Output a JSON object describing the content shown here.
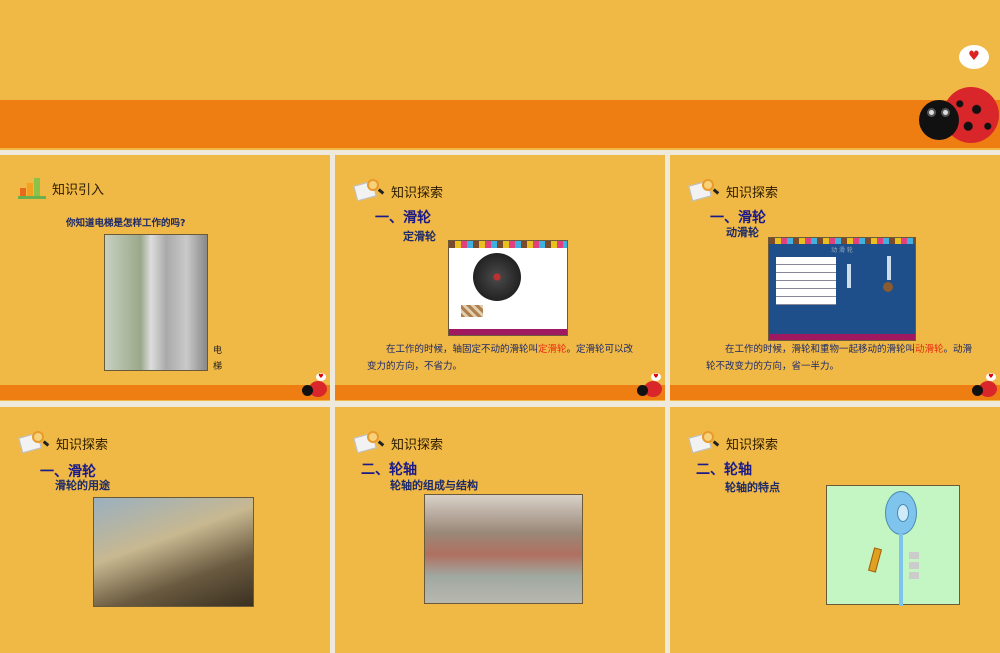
{
  "slides": [
    {
      "header": "知识引入",
      "question": "你知道电梯是怎样工作的吗?",
      "caption_chars": [
        "电",
        "梯"
      ]
    },
    {
      "header": "知识探索",
      "section": "一、滑轮",
      "subtitle": "定滑轮",
      "para_before": "在工作的时候，轴固定不动的滑轮叫",
      "para_highlight": "定滑轮",
      "para_after": "。定滑轮可以改变力的方向，不省力。"
    },
    {
      "header": "知识探索",
      "section": "一、滑轮",
      "subtitle": "动滑轮",
      "sim_title": "动 滑 轮",
      "para_before": "在工作的时候，滑轮和重物一起移动的滑轮叫",
      "para_highlight": "动滑轮",
      "para_after": "。动滑轮不改变力的方向，省一半力。"
    },
    {
      "header": "知识探索",
      "section": "一、滑轮",
      "subtitle": "滑轮的用途"
    },
    {
      "header": "知识探索",
      "section": "二、轮轴",
      "subtitle": "轮轴的组成与结构"
    },
    {
      "header": "知识探索",
      "section": "二、轮轴",
      "subtitle": "轮轴的特点"
    }
  ],
  "colors": {
    "background": "#f0b845",
    "band": "#ee7d12",
    "title": "#1a1a8a",
    "highlight": "#e82a10"
  },
  "heart": "♥"
}
